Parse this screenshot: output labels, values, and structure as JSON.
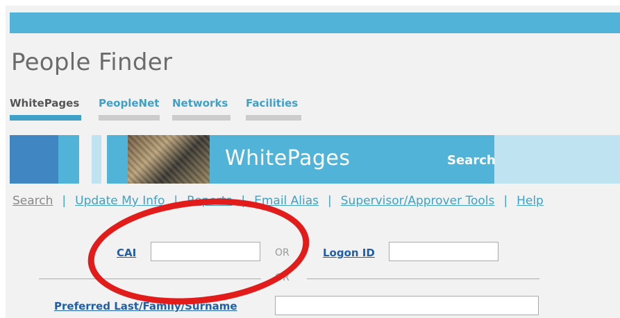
{
  "app": {
    "title": "People Finder"
  },
  "tabs": [
    {
      "label": "WhitePages",
      "active": true
    },
    {
      "label": "PeopleNet",
      "active": false
    },
    {
      "label": "Networks",
      "active": false
    },
    {
      "label": "Facilities",
      "active": false
    }
  ],
  "banner": {
    "title": "WhitePages",
    "section": "Search"
  },
  "subnav": [
    {
      "label": "Search",
      "active": true
    },
    {
      "label": "Update My Info"
    },
    {
      "label": "Reports"
    },
    {
      "label": "Email Alias"
    },
    {
      "label": "Supervisor/Approver Tools"
    },
    {
      "label": "Help"
    }
  ],
  "subnav_separator": "|",
  "form": {
    "cai_label": "CAI",
    "cai_value": "",
    "or_text": "OR",
    "logon_label": "Logon ID",
    "logon_value": "",
    "divider_or": "OR",
    "surname_label": "Preferred Last/Family/Surname",
    "surname_value": ""
  },
  "colors": {
    "accent": "#52b3d9",
    "link": "#3fa0c8",
    "form_link": "#1f5fa8",
    "highlight": "#e21b1b"
  }
}
